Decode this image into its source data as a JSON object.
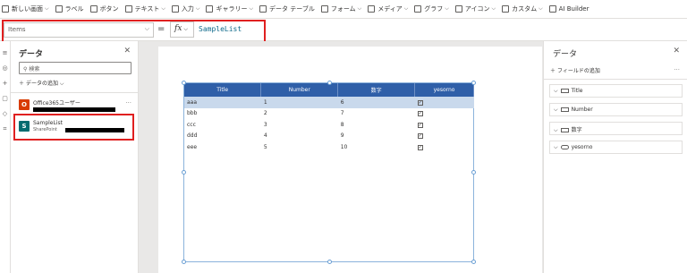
{
  "ribbon": {
    "items": [
      {
        "label": "新しい画面",
        "caret": true
      },
      {
        "label": "ラベル",
        "caret": false
      },
      {
        "label": "ボタン",
        "caret": false
      },
      {
        "label": "テキスト",
        "caret": true
      },
      {
        "label": "入力",
        "caret": true
      },
      {
        "label": "ギャラリー",
        "caret": true
      },
      {
        "label": "データ テーブル",
        "caret": false
      },
      {
        "label": "フォーム",
        "caret": true
      },
      {
        "label": "メディア",
        "caret": true
      },
      {
        "label": "グラフ",
        "caret": true
      },
      {
        "label": "アイコン",
        "caret": true
      },
      {
        "label": "カスタム",
        "caret": true
      },
      {
        "label": "AI Builder",
        "caret": false
      }
    ]
  },
  "formula_bar": {
    "property": "Items",
    "equals": "=",
    "fx_label": "fx",
    "formula": "SampleList"
  },
  "data_pane": {
    "title": "データ",
    "search_placeholder": "検索",
    "add_data_label": "データの追加",
    "connections": [
      {
        "name": "Office365ユーザー",
        "sub": "",
        "icon_color": "#d83b01"
      },
      {
        "name": "SampleList",
        "sub": "SharePoint",
        "icon_color": "#036c70"
      }
    ]
  },
  "table": {
    "columns": [
      "Title",
      "Number",
      "数字",
      "yesorno"
    ],
    "rows": [
      {
        "title": "aaa",
        "number": "1",
        "suji": "6",
        "yesorno": true
      },
      {
        "title": "bbb",
        "number": "2",
        "suji": "7",
        "yesorno": true
      },
      {
        "title": "ccc",
        "number": "3",
        "suji": "8",
        "yesorno": true
      },
      {
        "title": "ddd",
        "number": "4",
        "suji": "9",
        "yesorno": true
      },
      {
        "title": "eee",
        "number": "5",
        "suji": "10",
        "yesorno": true
      }
    ]
  },
  "right_pane": {
    "title": "データ",
    "add_field_label": "フィールドの追加",
    "fields": [
      "Title",
      "Number",
      "数字",
      "yesorno"
    ]
  },
  "colors": {
    "header_bg": "#2f5fa8",
    "selected_row": "#c9d9ec",
    "highlight_box": "#e02020"
  }
}
